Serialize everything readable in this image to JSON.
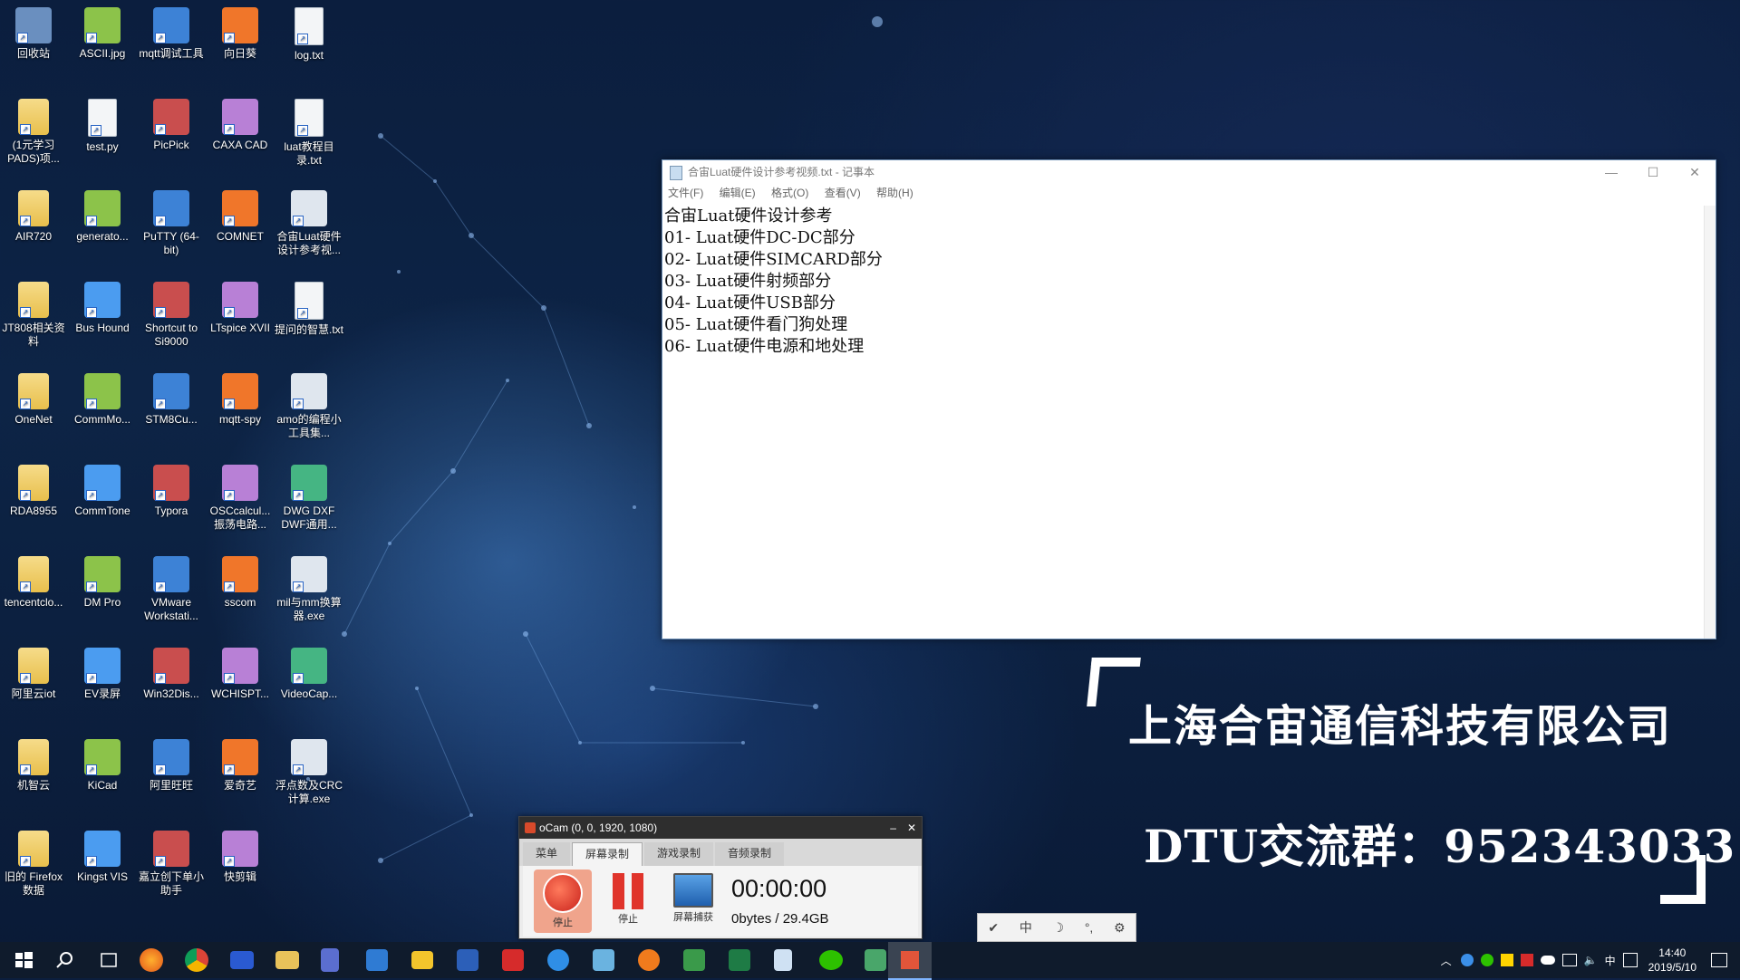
{
  "desktop": {
    "icons": [
      [
        "回收站",
        "ASCII.jpg",
        "mqtt调试工具",
        "向日葵",
        "log.txt"
      ],
      [
        "(1元学习PADS)项...",
        "test.py",
        "PicPick",
        "CAXA CAD",
        "luat教程目录.txt"
      ],
      [
        "AIR720",
        "generato...",
        "PuTTY (64-bit)",
        "COMNET",
        "合宙Luat硬件设计参考视..."
      ],
      [
        "JT808相关资料",
        "Bus Hound",
        "Shortcut to Si9000",
        "LTspice XVII",
        "提问的智慧.txt"
      ],
      [
        "OneNet",
        "CommMo...",
        "STM8Cu...",
        "mqtt-spy",
        "amo的编程小工具集..."
      ],
      [
        "RDA8955",
        "CommTone",
        "Typora",
        "OSCcalcul... 振荡电路...",
        "DWG DXF DWF通用..."
      ],
      [
        "tencentclo...",
        "DM Pro",
        "VMware Workstati...",
        "sscom",
        "mil与mm换算器.exe"
      ],
      [
        "阿里云iot",
        "EV录屏",
        "Win32Dis...",
        "WCHISPT...",
        "VideoCap..."
      ],
      [
        "机智云",
        "KiCad",
        "阿里旺旺",
        "爱奇艺",
        "浮点数及CRC计算.exe"
      ],
      [
        "旧的 Firefox 数据",
        "Kingst VIS",
        "嘉立创下单小助手",
        "快剪辑",
        ""
      ]
    ],
    "colors": {
      "bg": "#0b1e3e"
    }
  },
  "notepad": {
    "title": "合宙Luat硬件设计参考视频.txt - 记事本",
    "controls": {
      "minimize": "—",
      "maximize": "☐",
      "close": "✕"
    },
    "menu": [
      "文件(F)",
      "编辑(E)",
      "格式(O)",
      "查看(V)",
      "帮助(H)"
    ],
    "lines": [
      "合宙Luat硬件设计参考",
      "01- Luat硬件DC-DC部分",
      "02- Luat硬件SIMCARD部分",
      "03- Luat硬件射频部分",
      "04- Luat硬件USB部分",
      "05- Luat硬件看门狗处理",
      "06- Luat硬件电源和地处理"
    ]
  },
  "promo": {
    "company": "上海合宙通信科技有限公司",
    "group": "DTU交流群：952343033"
  },
  "ocam": {
    "title": "oCam (0, 0, 1920, 1080)",
    "tabs": [
      "菜单",
      "屏幕录制",
      "游戏录制",
      "音频录制"
    ],
    "active_tab": "屏幕录制",
    "buttons": [
      "停止",
      "停止",
      "屏幕捕获"
    ],
    "time": "00:00:00",
    "size": "0bytes / 29.4GB"
  },
  "ime": {
    "items": [
      "✔",
      "中",
      "☽",
      "°,",
      "⚙"
    ]
  },
  "taskbar": {
    "clock_time": "14:40",
    "clock_date": "2019/5/10",
    "ime_label": "中"
  }
}
